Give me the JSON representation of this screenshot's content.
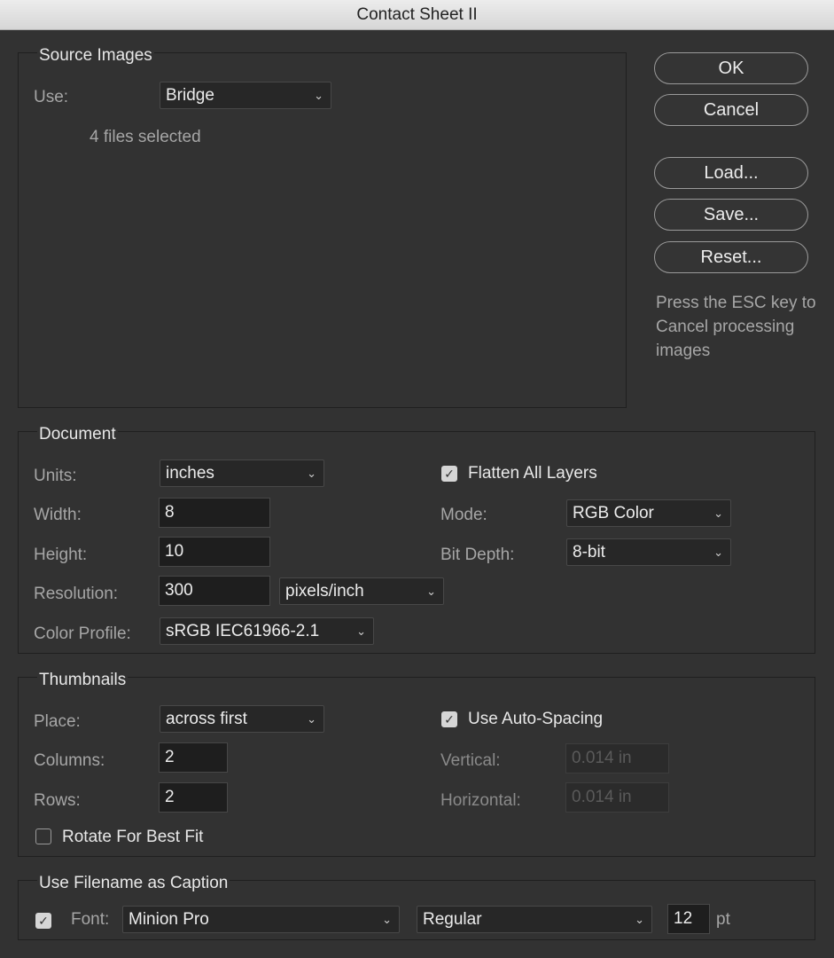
{
  "window": {
    "title": "Contact Sheet II"
  },
  "source_images": {
    "legend": "Source Images",
    "use_label": "Use:",
    "use_value": "Bridge",
    "files_info": "4 files selected"
  },
  "buttons": {
    "ok": "OK",
    "cancel": "Cancel",
    "load": "Load...",
    "save": "Save...",
    "reset": "Reset..."
  },
  "note_text": "Press the ESC key to Cancel processing images",
  "document": {
    "legend": "Document",
    "units_label": "Units:",
    "units_value": "inches",
    "width_label": "Width:",
    "width_value": "8",
    "height_label": "Height:",
    "height_value": "10",
    "resolution_label": "Resolution:",
    "resolution_value": "300",
    "resolution_unit": "pixels/inch",
    "color_profile_label": "Color Profile:",
    "color_profile_value": "sRGB IEC61966-2.1",
    "flatten_label": "Flatten All Layers",
    "flatten_checked": true,
    "mode_label": "Mode:",
    "mode_value": "RGB Color",
    "bit_depth_label": "Bit Depth:",
    "bit_depth_value": "8-bit"
  },
  "thumbnails": {
    "legend": "Thumbnails",
    "place_label": "Place:",
    "place_value": "across first",
    "columns_label": "Columns:",
    "columns_value": "2",
    "rows_label": "Rows:",
    "rows_value": "2",
    "rotate_label": "Rotate For Best Fit",
    "rotate_checked": false,
    "auto_spacing_label": "Use Auto-Spacing",
    "auto_spacing_checked": true,
    "vertical_label": "Vertical:",
    "vertical_placeholder": "0.014 in",
    "horizontal_label": "Horizontal:",
    "horizontal_placeholder": "0.014 in"
  },
  "caption": {
    "legend": "Use Filename as Caption",
    "enabled": true,
    "font_label": "Font:",
    "font_value": "Minion Pro",
    "style_value": "Regular",
    "size_value": "12",
    "size_unit": "pt"
  },
  "icons": {
    "check": "checkmark-icon",
    "chevron": "chevron-down-icon"
  }
}
